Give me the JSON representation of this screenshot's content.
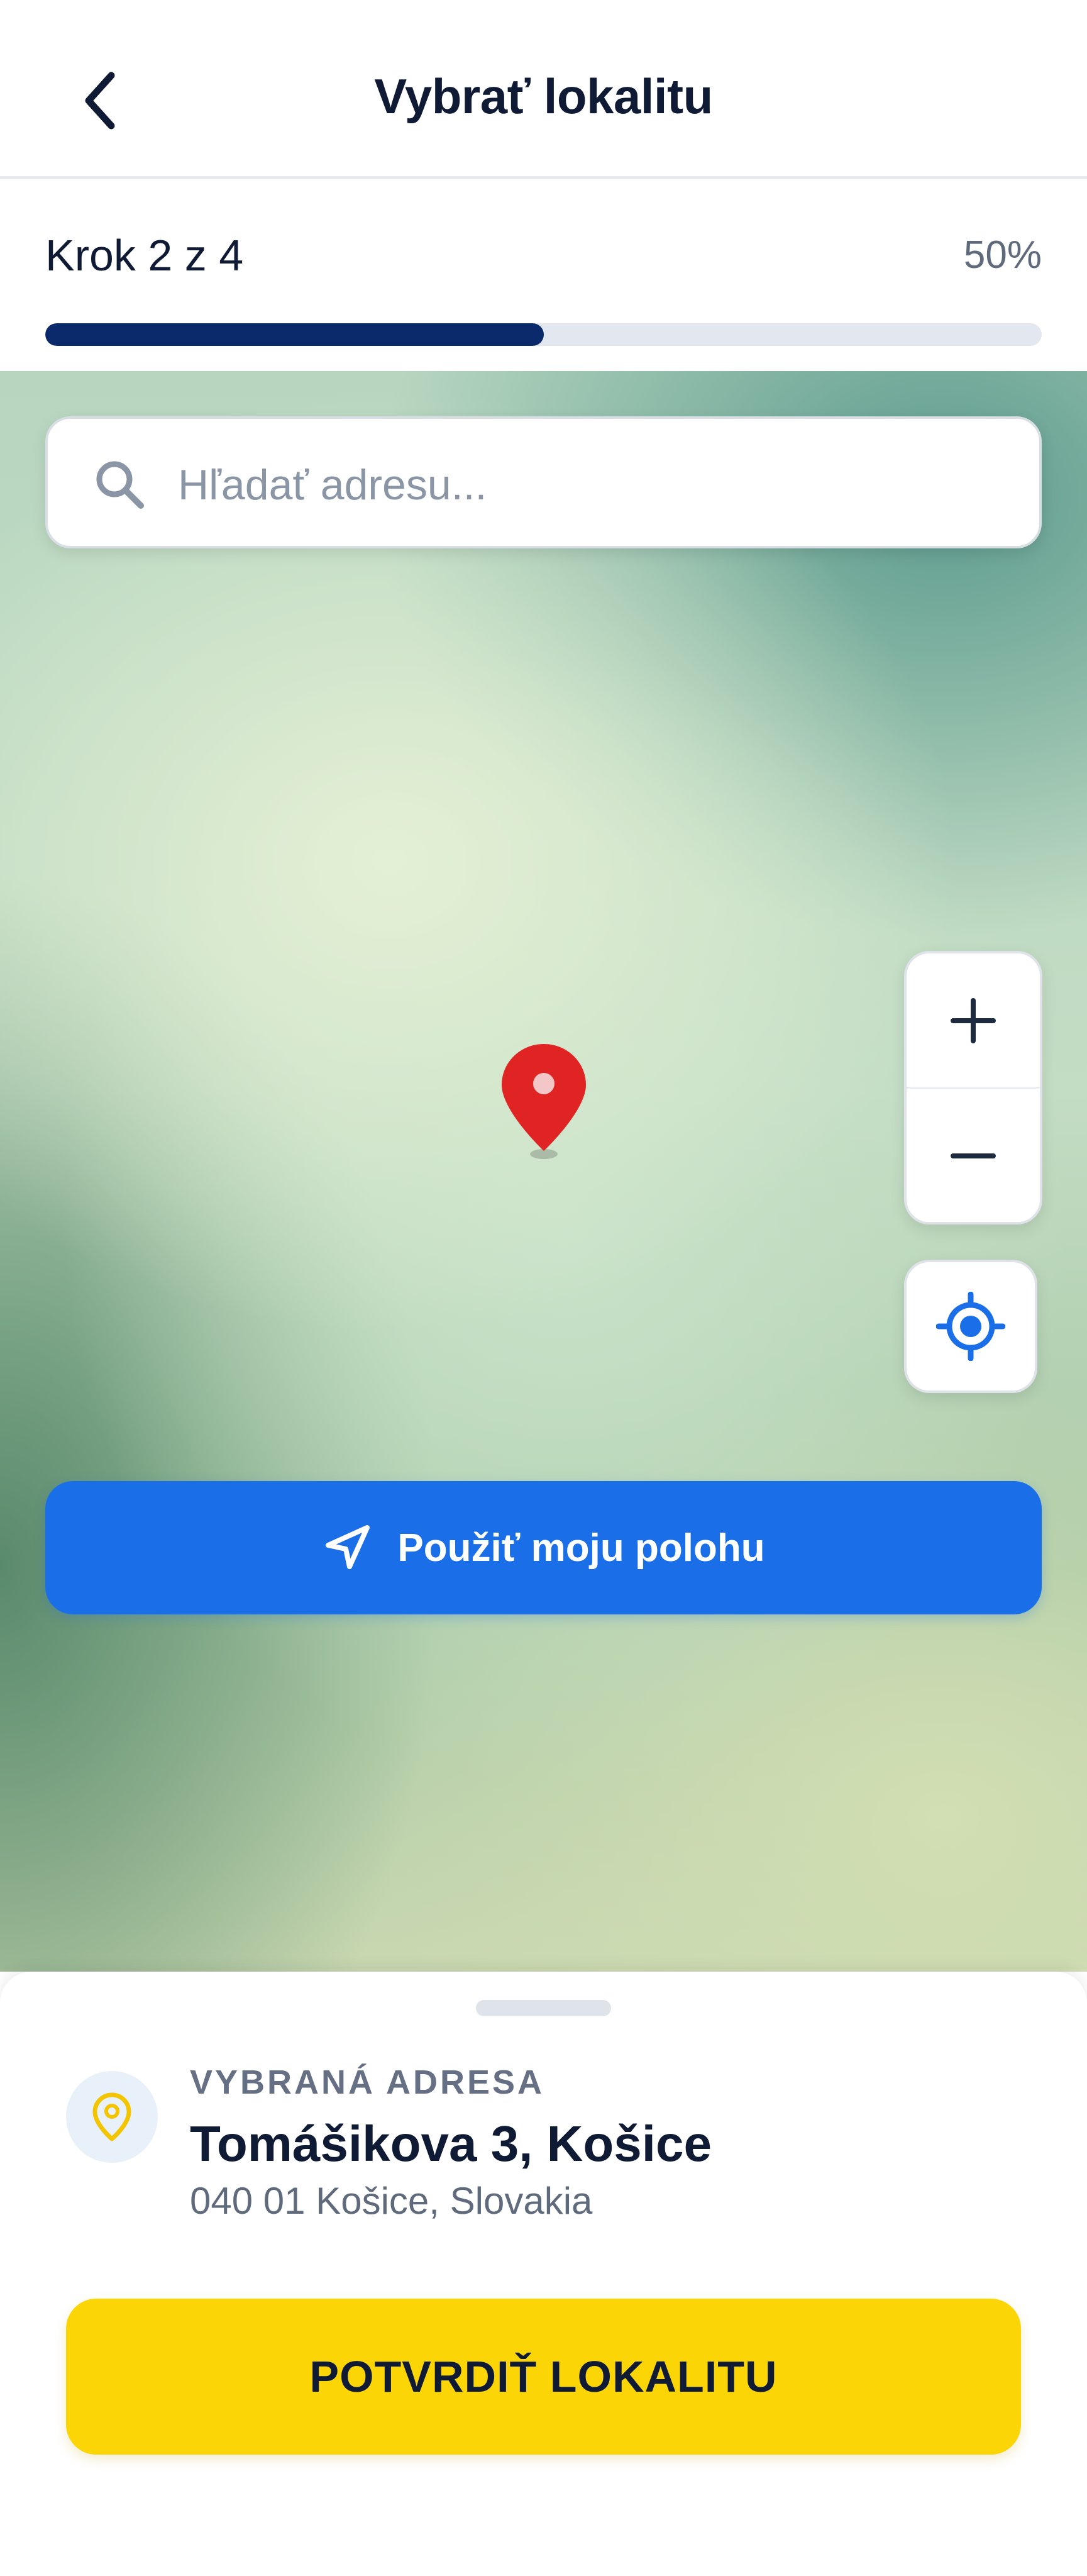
{
  "header": {
    "title": "Vybrať lokalitu",
    "back_icon": "chevron-left-icon"
  },
  "progress": {
    "step_text": "Krok 2 z 4",
    "percent_text": "50%",
    "value": 0.5,
    "fill_color": "#0b2a6b",
    "track_color": "#e3e8f0"
  },
  "search": {
    "placeholder": "Hľadať adresu...",
    "value": "",
    "icon": "search-icon"
  },
  "map": {
    "pin_icon": "map-pin-icon",
    "pin_color": "#e02424",
    "zoom_in_icon": "plus-icon",
    "zoom_out_icon": "minus-icon",
    "locate_icon": "crosshair-icon"
  },
  "use_location": {
    "label": "Použiť moju polohu",
    "icon": "navigation-arrow-icon",
    "color": "#1a6fe8"
  },
  "selected_address": {
    "label": "VYBRANÁ ADRESA",
    "title": "Tomášikova 3, Košice",
    "subtitle": "040 01 Košice, Slovakia",
    "icon": "location-pin-icon"
  },
  "confirm": {
    "label": "POTVRDIŤ LOKALITU",
    "color": "#fcd507"
  }
}
